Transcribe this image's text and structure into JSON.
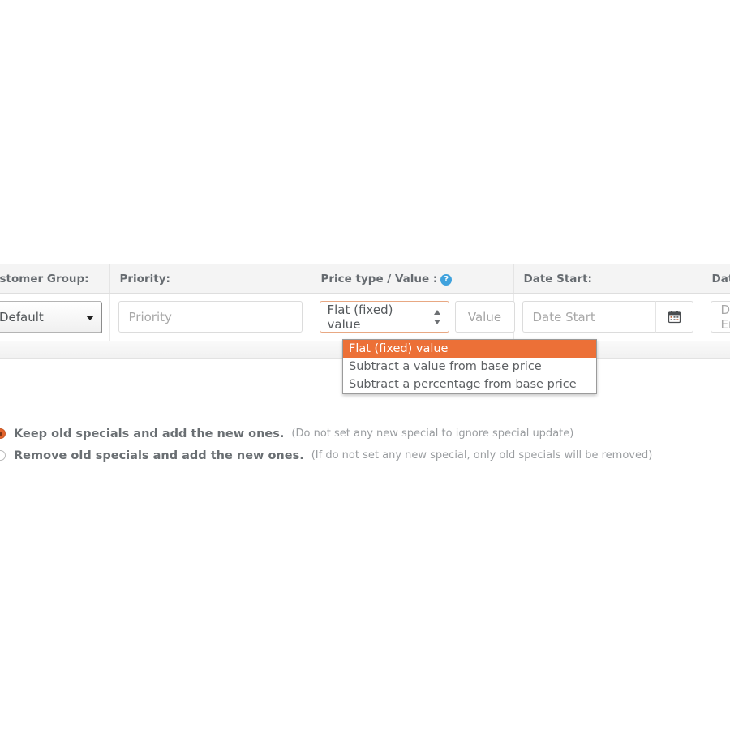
{
  "specials_table": {
    "columns": [
      {
        "label": "Customer Group:",
        "help": false
      },
      {
        "label": "Priority:",
        "help": false
      },
      {
        "label": "Price type / Value :",
        "help": true,
        "help_glyph": "?"
      },
      {
        "label": "Date Start:",
        "help": false
      },
      {
        "label": "Date End:",
        "help": false
      }
    ],
    "row": {
      "customer_group": {
        "selected": "Default",
        "caret_icon": "caret-down-icon"
      },
      "priority": {
        "value": "",
        "placeholder": "Priority"
      },
      "price_type": {
        "selected": "Flat (fixed) value",
        "spinner_icon": "spinner-updown-icon",
        "options": [
          "Flat (fixed) value",
          "Subtract a value from base price",
          "Subtract a percentage from base price"
        ]
      },
      "price_value": {
        "value": "",
        "placeholder": "Value"
      },
      "date_start": {
        "value": "",
        "placeholder": "Date Start",
        "addon_icon": "calendar-icon"
      },
      "date_end": {
        "value": "",
        "placeholder": "Date End",
        "addon_icon": "calendar-icon"
      }
    }
  },
  "dropdown": {
    "open": true,
    "selected_index": 0,
    "highlight_color": "#ec7037",
    "options": [
      "Flat (fixed) value",
      "Subtract a value from base price",
      "Subtract a percentage from base price"
    ]
  },
  "specials_mode": {
    "options": [
      {
        "label": "Keep old specials and add the new ones.",
        "note": "(Do not set any new special to ignore special update)",
        "checked": true
      },
      {
        "label": "Remove old specials and add the new ones.",
        "note": "(If do not set any new special, only old specials will be removed)",
        "checked": false
      }
    ],
    "accent_color": "#e2622b"
  }
}
